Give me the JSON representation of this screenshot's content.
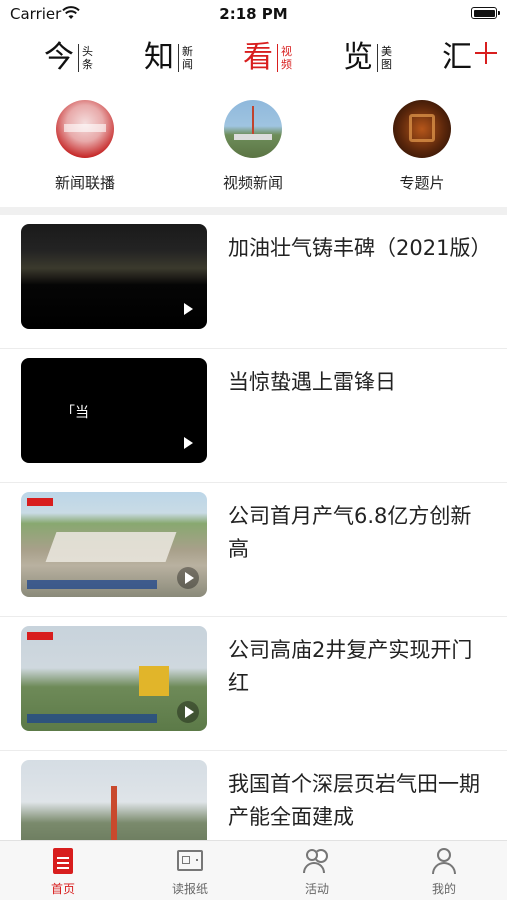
{
  "status_bar": {
    "carrier": "Carrier",
    "time": "2:18 PM"
  },
  "channels": [
    {
      "big": "今",
      "small": "头条",
      "active": false
    },
    {
      "big": "知",
      "small": "新闻",
      "active": false
    },
    {
      "big": "看",
      "small": "视频",
      "active": true
    },
    {
      "big": "览",
      "small": "美图",
      "active": false
    },
    {
      "big": "汇",
      "small": "",
      "active": false
    }
  ],
  "subcategories": [
    {
      "label": "新闻联播",
      "icon": "news-broadcast-thumbnail"
    },
    {
      "label": "视频新闻",
      "icon": "video-news-thumbnail"
    },
    {
      "label": "专题片",
      "icon": "special-feature-thumbnail"
    }
  ],
  "videos": [
    {
      "title": "加油壮气铸丰碑（2021版）"
    },
    {
      "title": "当惊蛰遇上雷锋日",
      "overlay": "「当"
    },
    {
      "title": "公司首月产气6.8亿方创新高"
    },
    {
      "title": "公司高庙2井复产实现开门红"
    },
    {
      "title": "我国首个深层页岩气田一期产能全面建成"
    }
  ],
  "tabs": [
    {
      "label": "首页",
      "icon": "home-icon",
      "active": true
    },
    {
      "label": "读报纸",
      "icon": "newspaper-icon",
      "active": false
    },
    {
      "label": "活动",
      "icon": "activity-icon",
      "active": false
    },
    {
      "label": "我的",
      "icon": "profile-icon",
      "active": false
    }
  ],
  "colors": {
    "accent": "#d81e1e",
    "tab_inactive": "#666666",
    "divider": "#f0f0f0"
  }
}
